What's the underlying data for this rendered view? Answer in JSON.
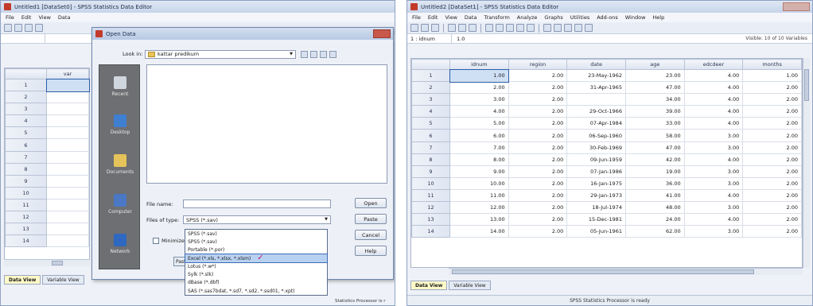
{
  "left": {
    "title": "Untitled1 [DataSet0] - SPSS Statistics Data Editor",
    "menu": [
      "File",
      "Edit",
      "View",
      "Data"
    ],
    "column_header": "var",
    "rows": [
      "1",
      "2",
      "3",
      "4",
      "5",
      "6",
      "7",
      "8",
      "9",
      "10",
      "11",
      "12",
      "13",
      "14"
    ],
    "tabs": [
      "Data View",
      "Variable View"
    ],
    "status_partial": "Statistics Processor is r"
  },
  "dialog": {
    "title": "Open Data",
    "look_in_label": "Look in:",
    "look_in_value": "kattar predikum",
    "places": [
      "Recent",
      "Desktop",
      "Documents",
      "Computer",
      "Network"
    ],
    "file_name_label": "File name:",
    "file_name_value": "",
    "files_of_type_label": "Files of type:",
    "files_of_type_value": "SPSS (*.sav)",
    "file_types": [
      "SPSS (*.sav)",
      "SPSS (*.sav)",
      "Portable (*.por)",
      "Excel (*.xls, *.xlsx, *.xlsm)",
      "Lotus (*.w*)",
      "Sylk (*.slk)",
      "dBase (*.dbf)",
      "SAS (*.sas7bdat, *.sd7, *.sd2, *.ssd01, *.xpt)"
    ],
    "selected_type_index": 3,
    "check_mark": "✓",
    "minimize_label": "Minimize",
    "paste_label": "Past",
    "buttons": [
      "Open",
      "Paste",
      "Cancel",
      "Help"
    ]
  },
  "right": {
    "title": "Untitled2 [DataSet1] - SPSS Statistics Data Editor",
    "menu": [
      "File",
      "Edit",
      "View",
      "Data",
      "Transform",
      "Analyze",
      "Graphs",
      "Utilities",
      "Add-ons",
      "Window",
      "Help"
    ],
    "cell_ref": "1 : idnum",
    "cell_value": "1.0",
    "visible_count": "Visible: 10 of 10 Variables",
    "columns": [
      "idnum",
      "region",
      "date",
      "age",
      "edcdeer",
      "months"
    ],
    "rows": [
      [
        "1",
        "1.00",
        "2.00",
        "23-May-1962",
        "23.00",
        "4.00",
        "1.00"
      ],
      [
        "2",
        "2.00",
        "2.00",
        "31-Apr-1965",
        "47.00",
        "4.00",
        "2.00"
      ],
      [
        "3",
        "3.00",
        "2.00",
        "",
        "34.00",
        "4.00",
        "2.00"
      ],
      [
        "4",
        "4.00",
        "2.00",
        "29-Oct-1966",
        "39.00",
        "4.00",
        "2.00"
      ],
      [
        "5",
        "5.00",
        "2.00",
        "07-Apr-1984",
        "33.00",
        "4.00",
        "2.00"
      ],
      [
        "6",
        "6.00",
        "2.00",
        "06-Sep-1960",
        "58.00",
        "3.00",
        "2.00"
      ],
      [
        "7",
        "7.00",
        "2.00",
        "30-Feb-1969",
        "47.00",
        "3.00",
        "2.00"
      ],
      [
        "8",
        "8.00",
        "2.00",
        "09-Jun-1959",
        "42.00",
        "4.00",
        "2.00"
      ],
      [
        "9",
        "9.00",
        "2.00",
        "07-Jan-1986",
        "19.00",
        "3.00",
        "2.00"
      ],
      [
        "10",
        "10.00",
        "2.00",
        "16-Jan-1975",
        "36.00",
        "3.00",
        "2.00"
      ],
      [
        "11",
        "11.00",
        "2.00",
        "29-Jan-1973",
        "41.00",
        "4.00",
        "2.00"
      ],
      [
        "12",
        "12.00",
        "2.00",
        "18-Jul-1974",
        "48.00",
        "3.00",
        "2.00"
      ],
      [
        "13",
        "13.00",
        "2.00",
        "15-Dec-1981",
        "24.00",
        "4.00",
        "2.00"
      ],
      [
        "14",
        "14.00",
        "2.00",
        "05-Jun-1961",
        "62.00",
        "3.00",
        "2.00"
      ]
    ],
    "tabs": [
      "Data View",
      "Variable View"
    ],
    "status": "SPSS Statistics Processor is ready"
  }
}
